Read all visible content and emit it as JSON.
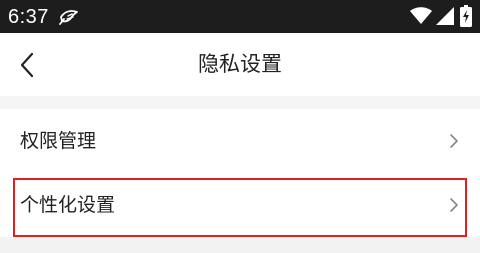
{
  "status_bar": {
    "time": "6:37",
    "app_icon": "feather-notification-icon",
    "wifi_icon": "wifi-icon",
    "signal_icon": "cell-signal-icon",
    "battery_icon": "battery-charging-icon",
    "background_color": "#1d1d1d"
  },
  "header": {
    "title": "隐私设置",
    "back_icon": "chevron-left-icon"
  },
  "list": {
    "items": [
      {
        "label": "权限管理",
        "icon": "chevron-right-icon"
      },
      {
        "label": "个性化设置",
        "icon": "chevron-right-icon",
        "highlighted": true
      }
    ]
  },
  "colors": {
    "highlight": "#e02020",
    "page_background": "#f5f5f5"
  }
}
